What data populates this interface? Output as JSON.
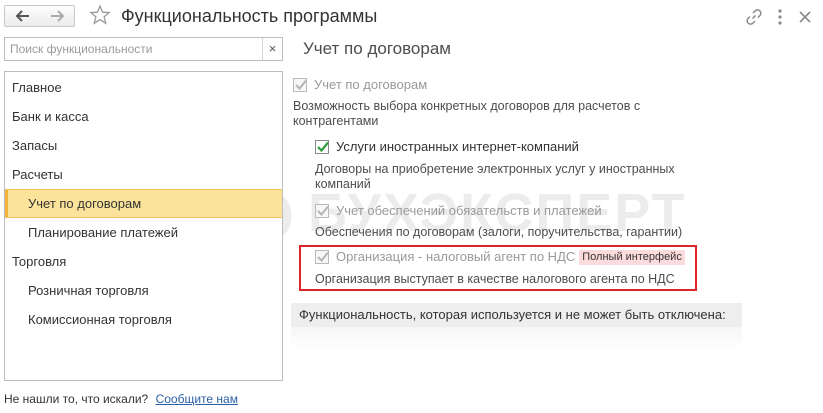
{
  "window": {
    "title": "Функциональность программы",
    "icons": {
      "back": "arrow-left-icon",
      "forward": "arrow-right-icon",
      "favorite": "star-icon",
      "link": "link-icon",
      "more": "more-vertical-icon",
      "close": "close-icon"
    }
  },
  "search": {
    "placeholder": "Поиск функциональности",
    "value": "",
    "clear_label": "×"
  },
  "sidebar": {
    "items": [
      {
        "label": "Главное",
        "level": 0,
        "selected": false
      },
      {
        "label": "Банк и касса",
        "level": 0,
        "selected": false
      },
      {
        "label": "Запасы",
        "level": 0,
        "selected": false
      },
      {
        "label": "Расчеты",
        "level": 0,
        "selected": false
      },
      {
        "label": "Учет по договорам",
        "level": 1,
        "selected": true
      },
      {
        "label": "Планирование платежей",
        "level": 1,
        "selected": false
      },
      {
        "label": "Торговля",
        "level": 0,
        "selected": false
      },
      {
        "label": "Розничная торговля",
        "level": 1,
        "selected": false
      },
      {
        "label": "Комиссионная торговля",
        "level": 1,
        "selected": false
      }
    ]
  },
  "footer": {
    "question": "Не нашли то, что искали?",
    "report_link": "Сообщите нам"
  },
  "main": {
    "section_title": "Учет по договорам",
    "options": [
      {
        "label": "Учет по договорам",
        "checked": true,
        "enabled": false,
        "description": "Возможность выбора конкретных договоров для расчетов с контрагентами"
      },
      {
        "label": "Услуги иностранных интернет-компаний",
        "checked": true,
        "enabled": true,
        "description": "Договоры на приобретение электронных услуг у иностранных компаний"
      },
      {
        "label": "Учет обеспечений обязательств и платежей",
        "checked": true,
        "enabled": false,
        "description": "Обеспечения по договорам (залоги, поручительства, гарантии)"
      },
      {
        "label": "Организация - налоговый агент по НДС",
        "checked": true,
        "enabled": false,
        "badge": "Полный интерфейс",
        "description": "Организация выступает в качестве налогового агента по НДС",
        "highlighted": true
      }
    ],
    "used_header": "Функциональность, которая используется и не может быть отключена:"
  },
  "watermark": "БУХЭКСПЕРТ",
  "colors": {
    "selected_bg": "#fbe39a",
    "highlight_border": "#e0232b",
    "check_active": "#2e9d3a",
    "check_disabled": "#b5b5b5",
    "link": "#2a5ea8",
    "badge_bg": "#fbdbdb"
  }
}
